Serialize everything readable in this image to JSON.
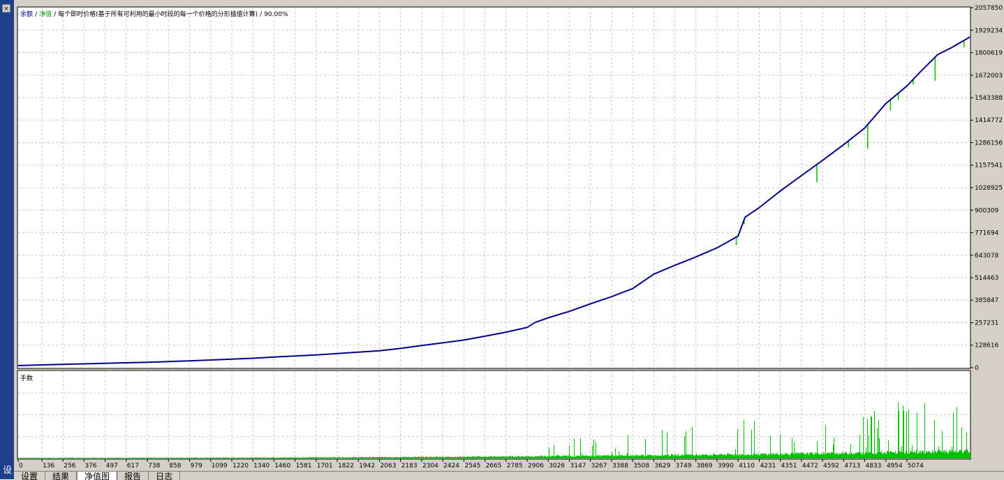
{
  "window": {
    "left_label": "设"
  },
  "legend": {
    "balance": "余额",
    "equity": "净值",
    "description": "每个即时价格(基于所有可利用的最小时段的每一个价格的分形插值计算)",
    "quality": "90.00%",
    "sep": "/"
  },
  "subchart_label": "手数",
  "tabs": [
    {
      "label": "设置",
      "active": false
    },
    {
      "label": "结果",
      "active": false
    },
    {
      "label": "净值图",
      "active": true
    },
    {
      "label": "报告",
      "active": false
    },
    {
      "label": "日志",
      "active": false
    }
  ],
  "colors": {
    "balance": "#00008b",
    "equity": "#00c000",
    "lots": "#00c000",
    "grid": "#c8c8c8",
    "frame": "#d4d0c8",
    "strip": "#1e3f8a"
  },
  "chart_data": {
    "type": "line",
    "grid": true,
    "x_ticks": [
      "0",
      "136",
      "256",
      "376",
      "497",
      "617",
      "738",
      "858",
      "979",
      "1099",
      "1220",
      "1340",
      "1460",
      "1581",
      "1701",
      "1822",
      "1942",
      "2063",
      "2183",
      "2304",
      "2424",
      "2545",
      "2665",
      "2785",
      "2906",
      "3026",
      "3147",
      "3267",
      "3388",
      "3508",
      "3629",
      "3749",
      "3869",
      "3990",
      "4110",
      "4231",
      "4351",
      "4472",
      "4592",
      "4713",
      "4833",
      "4954",
      "5074"
    ],
    "xlim": [
      0,
      5433
    ],
    "y_ticks": [
      "0",
      "128616",
      "257231",
      "385847",
      "514463",
      "643078",
      "771694",
      "900309",
      "1028925",
      "1157541",
      "1286156",
      "1414772",
      "1543388",
      "1672003",
      "1800619",
      "1929234",
      "2057850"
    ],
    "ylim": [
      0,
      2057850
    ],
    "series": [
      {
        "name": "余额",
        "x": [
          0,
          136,
          256,
          376,
          497,
          617,
          738,
          858,
          979,
          1099,
          1220,
          1340,
          1460,
          1581,
          1701,
          1822,
          1942,
          2063,
          2183,
          2304,
          2424,
          2545,
          2665,
          2785,
          2906,
          2950,
          3026,
          3147,
          3267,
          3388,
          3508,
          3629,
          3749,
          3869,
          3990,
          4110,
          4150,
          4231,
          4351,
          4472,
          4592,
          4713,
          4833,
          4954,
          5074,
          5150,
          5250,
          5330,
          5433
        ],
        "y": [
          12000,
          16000,
          19000,
          22000,
          25000,
          28000,
          31000,
          35000,
          39000,
          44000,
          49000,
          54000,
          61000,
          67000,
          73000,
          81000,
          89000,
          97000,
          110000,
          127000,
          142000,
          158000,
          180000,
          203000,
          230000,
          258000,
          285000,
          322000,
          365000,
          406000,
          452000,
          535000,
          585000,
          633000,
          685000,
          752000,
          860000,
          915000,
          1010000,
          1098000,
          1185000,
          1275000,
          1370000,
          1510000,
          1610000,
          1690000,
          1790000,
          1830000,
          1890000
        ]
      }
    ],
    "equity_dips": [
      {
        "x": 3800,
        "y": 600000
      },
      {
        "x": 4100,
        "y": 700000
      },
      {
        "x": 4145,
        "y": 820000
      },
      {
        "x": 4190,
        "y": 890000
      },
      {
        "x": 4560,
        "y": 1060000
      },
      {
        "x": 4740,
        "y": 1260000
      },
      {
        "x": 4810,
        "y": 1350000
      },
      {
        "x": 4850,
        "y": 1250000
      },
      {
        "x": 4980,
        "y": 1470000
      },
      {
        "x": 5025,
        "y": 1530000
      },
      {
        "x": 5110,
        "y": 1620000
      },
      {
        "x": 5235,
        "y": 1640000
      },
      {
        "x": 5400,
        "y": 1830000
      }
    ]
  }
}
